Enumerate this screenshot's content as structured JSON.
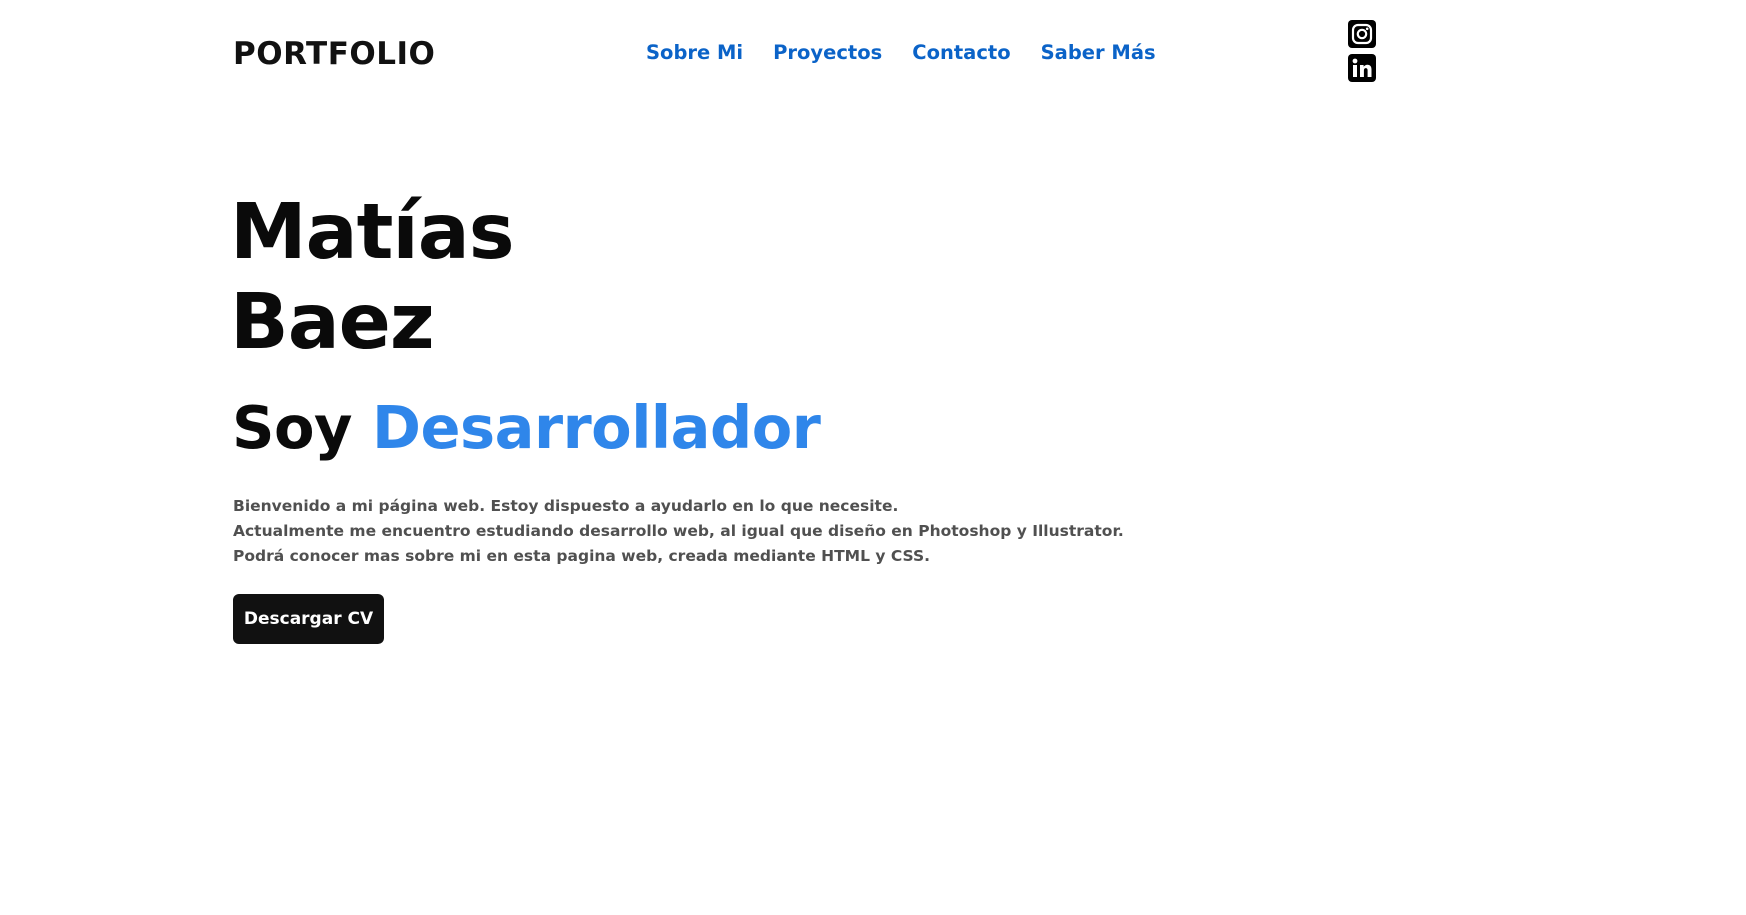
{
  "header": {
    "logo": "PORTFOLIO",
    "nav": [
      {
        "label": "Sobre Mi"
      },
      {
        "label": "Proyectos"
      },
      {
        "label": "Contacto"
      },
      {
        "label": "Saber Más"
      }
    ],
    "social": [
      {
        "icon": "instagram-icon"
      },
      {
        "icon": "linkedin-icon"
      }
    ]
  },
  "hero": {
    "first_name": "Matías",
    "last_name": "Baez",
    "role_prefix": "Soy",
    "role_accent": "Desarrollador",
    "intro_lines": [
      "Bienvenido a mi página web. Estoy dispuesto a ayudarlo en lo que necesite.",
      "Actualmente me encuentro estudiando desarrollo web, al igual que diseño en Photoshop y Illustrator.",
      "Podrá conocer mas sobre mi en esta pagina web, creada mediante HTML y CSS."
    ],
    "cv_button": "Descargar CV"
  },
  "colors": {
    "nav_link": "#0b63c8",
    "accent": "#2f86ea",
    "text": "#0a0a0a",
    "button_bg": "#111111"
  }
}
